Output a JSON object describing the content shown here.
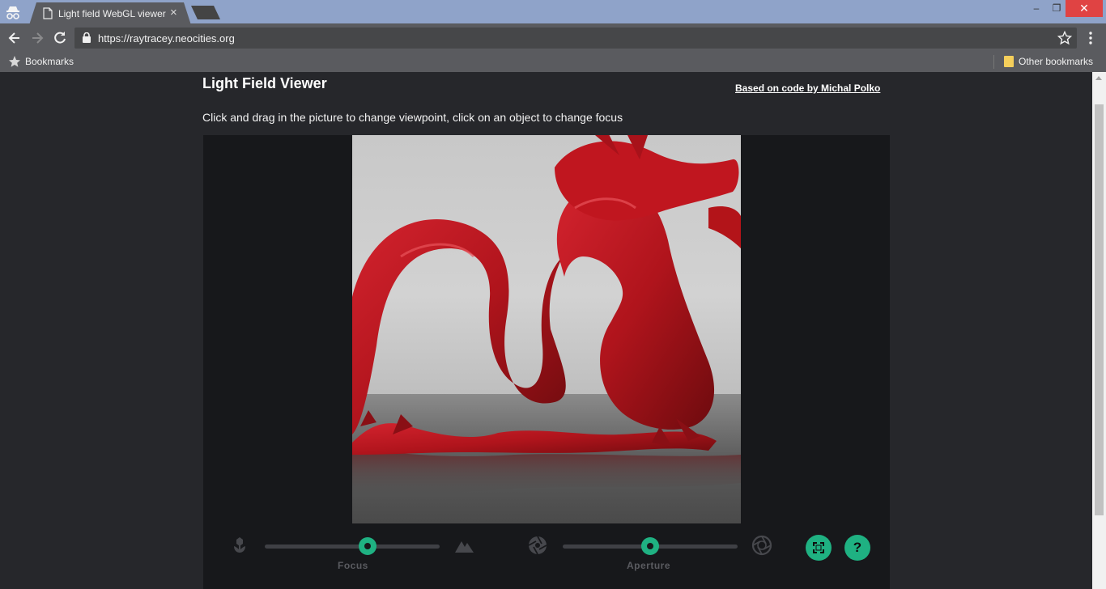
{
  "browser": {
    "tab_title": "Light field WebGL viewer",
    "tab_close": "×",
    "window_controls": {
      "minimize": "–",
      "maximize": "❐",
      "close": "✕"
    },
    "url": "https://raytracey.neocities.org",
    "bookmarks_label": "Bookmarks",
    "other_bookmarks_label": "Other bookmarks"
  },
  "page": {
    "title": "Light Field Viewer",
    "credit_link": "Based on code by Michal Polko",
    "instructions": "Click and drag in the picture to change viewpoint, click on an object to change focus"
  },
  "viewer": {
    "image_subject": "red dragon figurine on reflective floor",
    "focus": {
      "label": "Focus",
      "value": 0.59
    },
    "aperture": {
      "label": "Aperture",
      "value": 0.5
    },
    "help_label": "?",
    "accent_color": "#1fb182"
  },
  "icons": {
    "focus_near": "macro-flower-icon",
    "focus_far": "mountain-icon",
    "aperture_small": "aperture-closed-icon",
    "aperture_large": "aperture-open-icon",
    "fullscreen": "fullscreen-icon",
    "help": "help-icon"
  }
}
